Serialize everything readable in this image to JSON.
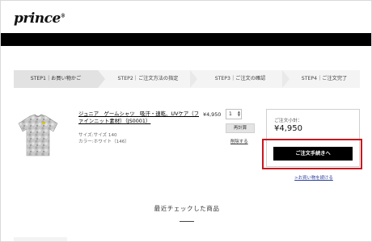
{
  "brand": {
    "logo_text": "prince",
    "logo_mark": "®"
  },
  "steps": [
    {
      "label": "STEP1｜お買い物かご",
      "active": true
    },
    {
      "label": "STEP2｜ご注文方法の指定",
      "active": false
    },
    {
      "label": "STEP3｜ご注文の確認",
      "active": false
    },
    {
      "label": "STEP4｜ご注文完了",
      "active": false
    }
  ],
  "cart": {
    "product_image_icon": "tshirt-icon",
    "product_name": "ジュニア　ゲームシャツ　吸汗・速乾、UVケア（ファインニット素材）（JS0001）",
    "size": "サイズ:サイズ 140",
    "color": "カラー:ホワイト（146）",
    "price": "¥4,950",
    "quantity": "1",
    "recalc_label": "再計算",
    "delete_label": "削除する"
  },
  "summary": {
    "subtotal_label": "ご注文小計：",
    "subtotal_value": "¥4,950",
    "checkout_label": "ご注文手続きへ",
    "continue_label": ">お買い物を続ける"
  },
  "recent": {
    "title": "最近チェックした商品"
  },
  "colors": {
    "accent_highlight": "#c8161d",
    "header_bar": "#000000",
    "link": "#2a3d9c"
  }
}
